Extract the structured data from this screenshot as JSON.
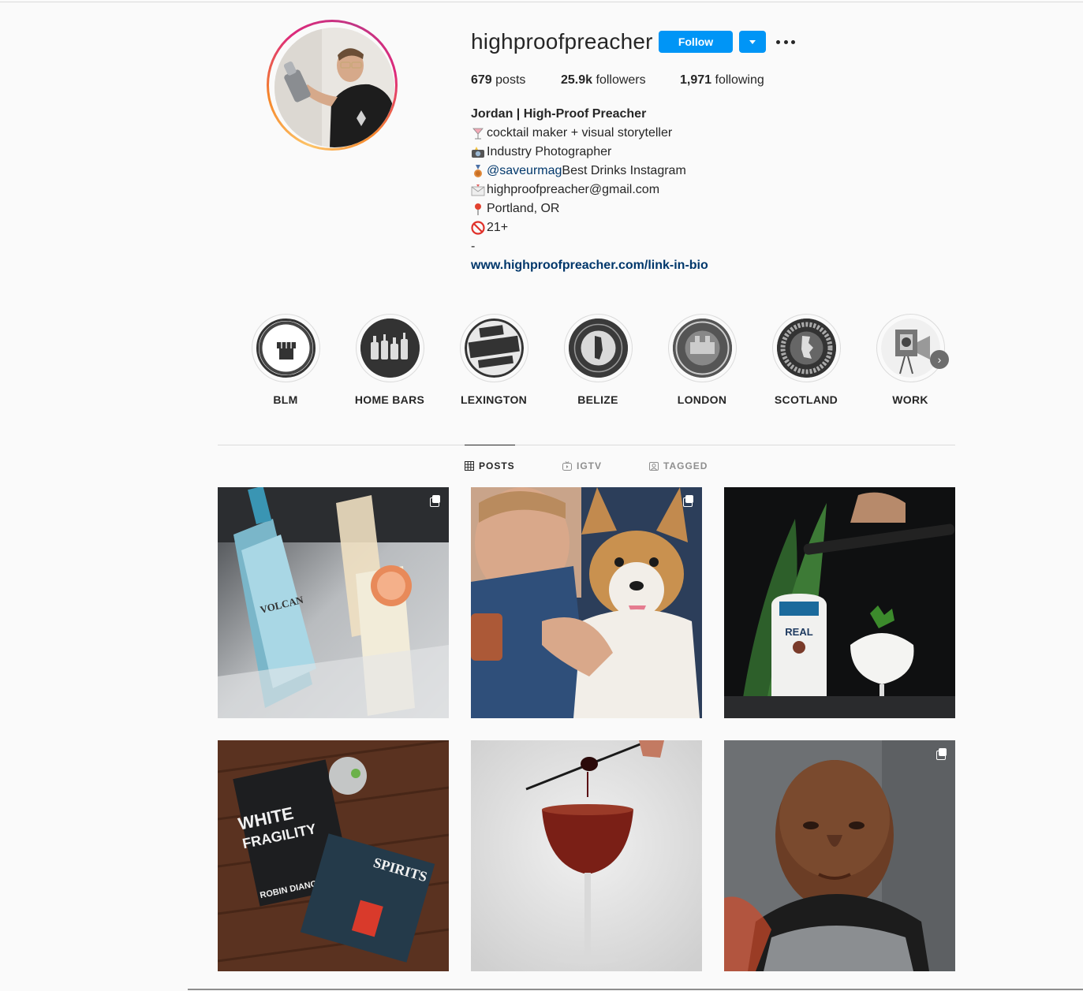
{
  "profile": {
    "username": "highproofpreacher",
    "follow_label": "Follow",
    "stats": {
      "posts_count": "679",
      "posts_label": " posts",
      "followers_count": "25.9k",
      "followers_label": " followers",
      "following_count": "1,971",
      "following_label": " following"
    },
    "bio": {
      "name": "Jordan | High-Proof Preacher",
      "line1": "cocktail maker + visual storyteller",
      "line2": "Industry Photographer",
      "line3_mention": "@saveurmag",
      "line3_rest": " Best Drinks Instagram",
      "line4": "highproofpreacher@gmail.com",
      "line5": "Portland, OR",
      "line6": "21+",
      "line7": "-",
      "link": "www.highproofpreacher.com/link-in-bio"
    }
  },
  "highlights": [
    {
      "label": "BLM"
    },
    {
      "label": "HOME BARS"
    },
    {
      "label": "LEXINGTON"
    },
    {
      "label": "BELIZE"
    },
    {
      "label": "LONDON"
    },
    {
      "label": "SCOTLAND"
    },
    {
      "label": "WORK"
    }
  ],
  "tabs": {
    "posts": "POSTS",
    "igtv": "IGTV",
    "tagged": "TAGGED"
  },
  "posts": {
    "p1_bottle_text": "VOLCAN",
    "p4_book1_title_a": "WHITE",
    "p4_book1_title_b": "FRAGILITY",
    "p4_book1_author": "ROBIN DIANGELO",
    "p4_book2_title": "SPIRITS",
    "p3_bottle_text": "REAL"
  }
}
